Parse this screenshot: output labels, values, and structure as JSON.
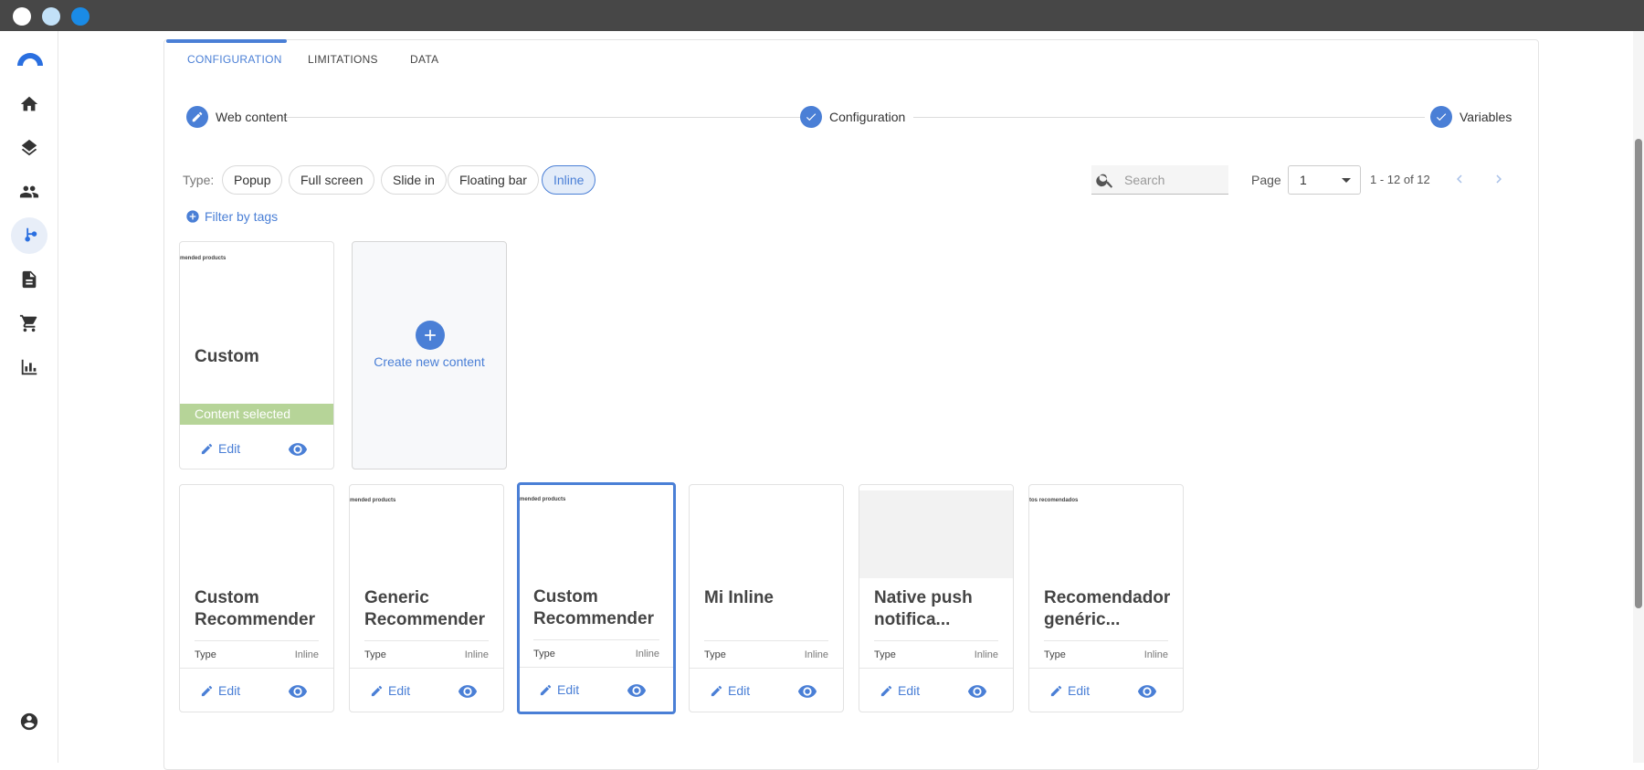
{
  "window": {
    "dots": [
      "#ffffff",
      "#c2e1f8",
      "#1a8be6"
    ]
  },
  "sidebar": {
    "items": [
      {
        "name": "home-icon"
      },
      {
        "name": "layers-icon"
      },
      {
        "name": "people-icon"
      },
      {
        "name": "flow-icon",
        "active": true
      },
      {
        "name": "document-icon"
      },
      {
        "name": "cart-icon"
      },
      {
        "name": "chart-icon"
      }
    ],
    "bottom": {
      "name": "account-icon"
    }
  },
  "tabs": [
    {
      "label": "CONFIGURATION",
      "active": true
    },
    {
      "label": "LIMITATIONS"
    },
    {
      "label": "DATA"
    }
  ],
  "steps": [
    {
      "label": "Web content",
      "icon": "pencil-icon"
    },
    {
      "label": "Configuration",
      "icon": "check-icon"
    },
    {
      "label": "Variables",
      "icon": "check-icon"
    }
  ],
  "type_filter": {
    "label": "Type:",
    "chips": [
      {
        "label": "Popup"
      },
      {
        "label": "Full screen"
      },
      {
        "label": "Slide in"
      },
      {
        "label": "Floating bar"
      },
      {
        "label": "Inline",
        "selected": true
      }
    ]
  },
  "filter_by_tags": "Filter by tags",
  "search": {
    "placeholder": "Search"
  },
  "pagination": {
    "label": "Page",
    "current": "1",
    "range": "1 - 12 of 12"
  },
  "create_card": {
    "label": "Create new content"
  },
  "selected_card": {
    "preview_text": "mended products",
    "title": "Custom Recommender",
    "selected_label": "Content selected",
    "edit_label": "Edit"
  },
  "cards": [
    {
      "preview_text": "",
      "title": "Custom Recommender",
      "type_label": "Type",
      "type_value": "Inline",
      "edit_label": "Edit"
    },
    {
      "preview_text": "mended products",
      "title": "Generic Recommender",
      "type_label": "Type",
      "type_value": "Inline",
      "edit_label": "Edit"
    },
    {
      "preview_text": "mended products",
      "title": "Custom Recommender",
      "type_label": "Type",
      "type_value": "Inline",
      "edit_label": "Edit",
      "highlight": true
    },
    {
      "preview_text": "",
      "title": "Mi Inline",
      "type_label": "Type",
      "type_value": "Inline",
      "edit_label": "Edit"
    },
    {
      "preview_text": "",
      "title": "Native push notifica...",
      "type_label": "Type",
      "type_value": "Inline",
      "edit_label": "Edit",
      "grey_preview": true
    },
    {
      "preview_text": "tos recomendados",
      "title": "Recomendador genéric...",
      "type_label": "Type",
      "type_value": "Inline",
      "edit_label": "Edit"
    }
  ],
  "colors": {
    "accent": "#4a7fd6",
    "selected_band": "#b6d498",
    "titlebar": "#474747"
  }
}
